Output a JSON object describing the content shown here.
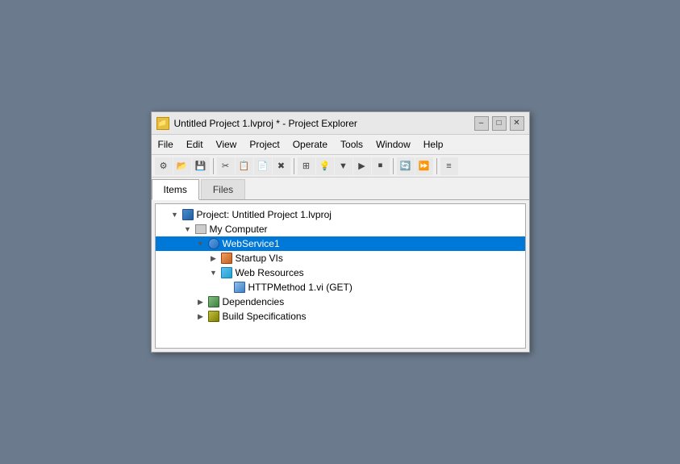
{
  "window": {
    "title": "Untitled Project 1.lvproj * - Project Explorer",
    "icon": "📁"
  },
  "titleControls": {
    "minimize": "–",
    "maximize": "□",
    "close": "✕"
  },
  "menuBar": {
    "items": [
      "File",
      "Edit",
      "View",
      "Project",
      "Operate",
      "Tools",
      "Window",
      "Help"
    ]
  },
  "tabs": {
    "items": [
      "Items",
      "Files"
    ],
    "active": 0
  },
  "tree": {
    "items": [
      {
        "label": "Project: Untitled Project 1.lvproj",
        "level": 0,
        "expanded": true,
        "selected": false,
        "icon": "project"
      },
      {
        "label": "My Computer",
        "level": 1,
        "expanded": true,
        "selected": false,
        "icon": "computer"
      },
      {
        "label": "WebService1",
        "level": 2,
        "expanded": true,
        "selected": true,
        "icon": "webservice"
      },
      {
        "label": "Startup VIs",
        "level": 3,
        "expanded": false,
        "selected": false,
        "icon": "startup"
      },
      {
        "label": "Web Resources",
        "level": 3,
        "expanded": true,
        "selected": false,
        "icon": "webres"
      },
      {
        "label": "HTTPMethod 1.vi (GET)",
        "level": 4,
        "expanded": false,
        "selected": false,
        "icon": "httpmethod"
      },
      {
        "label": "Dependencies",
        "level": 2,
        "expanded": false,
        "selected": false,
        "icon": "deps"
      },
      {
        "label": "Build Specifications",
        "level": 2,
        "expanded": false,
        "selected": false,
        "icon": "build"
      }
    ]
  },
  "toolbar": {
    "buttons": [
      "⚙",
      "📂",
      "💾",
      "|",
      "✂",
      "📋",
      "📄",
      "❌",
      "|",
      "📦",
      "💡",
      "|",
      "⬛",
      "▶",
      "⏹",
      "|",
      "🔄",
      "⏩"
    ]
  }
}
